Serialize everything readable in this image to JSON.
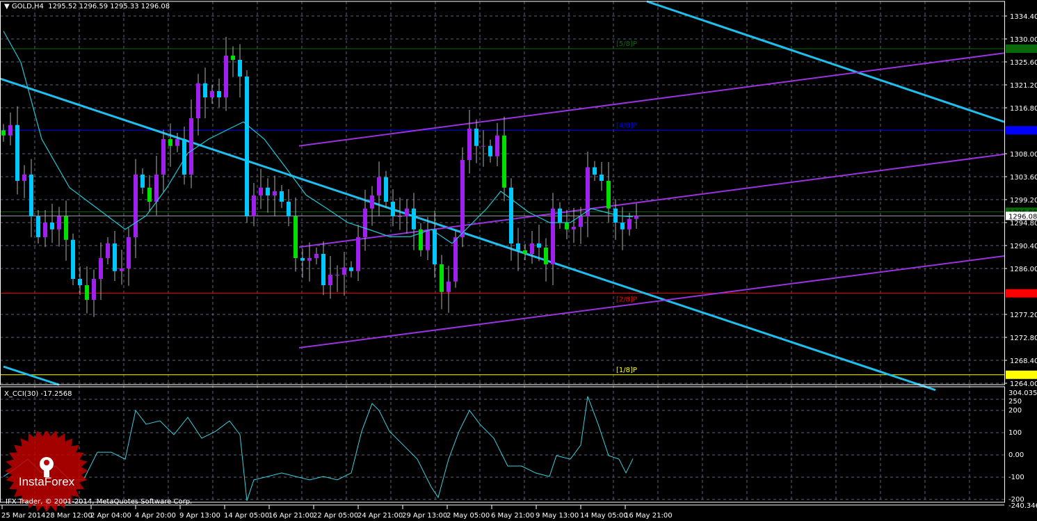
{
  "header": {
    "symbol": "GOLD,H4",
    "ohlc": "1295.52 1296.59 1295.33 1296.08",
    "menu_icon": "triangle-down-icon"
  },
  "indicator_title": "X_CCI(30) -17.2568",
  "copyright": "IFX Trader, © 2001-2014, MetaQuotes Software Corp.",
  "logo": {
    "text": "InstaForex",
    "color": "#c00000"
  },
  "colors": {
    "bull": "#a020f0",
    "bear": "#00c8ff",
    "ma": "#1fc8d8",
    "trend": "#1ec0f0",
    "channel": "#9a32e0",
    "cci": "#39d0e0",
    "grid": "#5a6478"
  },
  "chart_data": [
    {
      "type": "candlestick",
      "symbol": "GOLD",
      "timeframe": "H4",
      "ylim": [
        1264.0,
        1334.4
      ],
      "y_ticks": [
        "1334.40",
        "1330.00",
        "1325.60",
        "1321.20",
        "1316.80",
        "1308.00",
        "1303.60",
        "1299.20",
        "1294.80",
        "1290.40",
        "1286.00",
        "1277.20",
        "1272.80",
        "1268.40",
        "1264.00"
      ],
      "x_ticks": [
        "25 Mar 2014",
        "28 Mar 12:00",
        "2 Apr 04:00",
        "4 Apr 20:00",
        "9 Apr 13:00",
        "14 Apr 05:00",
        "16 Apr 21:00",
        "22 Apr 05:00",
        "24 Apr 21:00",
        "29 Apr 13:00",
        "2 May 05:00",
        "6 May 21:00",
        "9 May 13:00",
        "14 May 05:00",
        "16 May 21:00"
      ],
      "grid": true,
      "closes": [
        1311.5,
        1313.5,
        1302.8,
        1304,
        1296,
        1292,
        1294.8,
        1293.5,
        1296,
        1291.5,
        1284,
        1282.8,
        1280,
        1284,
        1288,
        1290.8,
        1285.5,
        1286,
        1292,
        1304,
        1301.5,
        1298.8,
        1304,
        1310.8,
        1309.5,
        1310.8,
        1304,
        1314.8,
        1321.5,
        1318.8,
        1320,
        1318.8,
        1326.8,
        1326,
        1322.8,
        1296,
        1300,
        1301.5,
        1300,
        1300.8,
        1298.8,
        1296,
        1288,
        1287.5,
        1288,
        1288.8,
        1282.8,
        1284.8,
        1284.8,
        1286.2,
        1285.5,
        1292,
        1297.5,
        1300,
        1303.5,
        1298.8,
        1296,
        1296,
        1297.5,
        1293.5,
        1289.5,
        1293.5,
        1286.8,
        1281.5,
        1283.5,
        1292,
        1306.8,
        1312.8,
        1309.5,
        1309.5,
        1307.5,
        1311.5,
        1301.5,
        1290.8,
        1289.5,
        1288.8,
        1290.8,
        1290,
        1286.8,
        1297.5,
        1294.8,
        1293.5,
        1294,
        1296,
        1305.4,
        1304,
        1302.8,
        1297.5,
        1294.8,
        1293.5,
        1295.5,
        1296.08
      ],
      "moving_average": [
        [
          0,
          1331.5
        ],
        [
          2.5,
          1325.5
        ],
        [
          5.5,
          1310.8
        ],
        [
          9.5,
          1301.5
        ],
        [
          13.5,
          1297.5
        ],
        [
          17.5,
          1293.5
        ],
        [
          20.5,
          1296.1
        ],
        [
          23.5,
          1301.5
        ],
        [
          26.5,
          1308.1
        ],
        [
          29.5,
          1310.8
        ],
        [
          32.5,
          1312.8
        ],
        [
          34.5,
          1314.1
        ],
        [
          37.5,
          1310.8
        ],
        [
          40.5,
          1305.5
        ],
        [
          43.5,
          1300.1
        ],
        [
          46.5,
          1297.5
        ],
        [
          49.5,
          1294.8
        ],
        [
          52.5,
          1293.5
        ],
        [
          55.5,
          1292.1
        ],
        [
          58.5,
          1292.1
        ],
        [
          61.5,
          1293.5
        ],
        [
          64.5,
          1290.8
        ],
        [
          66.5,
          1293.5
        ],
        [
          69.5,
          1297.5
        ],
        [
          71.5,
          1300.8
        ],
        [
          73.5,
          1298.8
        ],
        [
          75.5,
          1296.8
        ],
        [
          78.5,
          1294.8
        ],
        [
          81.5,
          1294.8
        ],
        [
          84.5,
          1297.5
        ],
        [
          86.5,
          1296.8
        ],
        [
          88.5,
          1296.1
        ],
        [
          90.5,
          1295.9
        ]
      ],
      "trend_lines": [
        {
          "from": [
            -0.5,
            1322.4
          ],
          "to": [
            134,
            1262.7
          ],
          "color": "#1ec0f0"
        },
        {
          "from": [
            92.5,
            1337.2
          ],
          "to": [
            143.9,
            1314.1
          ],
          "color": "#1ec0f0"
        },
        {
          "from": [
            0,
            1267.2
          ],
          "to": [
            8,
            1263.7
          ],
          "color": "#1ec0f0"
        },
        {
          "from": [
            42.5,
            1309.5
          ],
          "to": [
            143.9,
            1327.3
          ],
          "color": "#9a32e0"
        },
        {
          "from": [
            42.5,
            1290.1
          ],
          "to": [
            143.9,
            1307.9
          ],
          "color": "#9a32e0"
        },
        {
          "from": [
            42.5,
            1270.8
          ],
          "to": [
            143.9,
            1288.4
          ],
          "color": "#9a32e0"
        }
      ],
      "levels": [
        {
          "price": 1328.13,
          "label": "1328.13",
          "name": "[5/8]P",
          "color": "#0a6a0a",
          "text_color": "#0a6a0a"
        },
        {
          "price": 1312.5,
          "label": "1312.50",
          "name": "[4/8]P",
          "color": "#0000ff",
          "text_color": "#0000ff"
        },
        {
          "price": 1296.88,
          "label": "1296.88",
          "name": "",
          "color": "#0a6a0a",
          "text_color": "#000000"
        },
        {
          "price": 1296.08,
          "label": "1296.08",
          "name": "",
          "color": "#9aa0a8",
          "text_color": "#000000",
          "bg": "#ffffff"
        },
        {
          "price": 1281.25,
          "label": "1281.25",
          "name": "[2/8]P",
          "color": "#ff0000",
          "text_color": "#ff0000"
        },
        {
          "price": 1265.63,
          "label": "1265.63",
          "name": "[1/8]P",
          "color": "#ffff00",
          "text_color": "#ffff00"
        }
      ]
    },
    {
      "type": "line",
      "title": "X_CCI(30) -17.2568",
      "ylim": [
        -240.3463,
        304.0354
      ],
      "y_ticks": [
        "304.0354",
        "250",
        "200",
        "100",
        "0.00",
        "-100",
        "-200",
        "-240.3463"
      ],
      "values": [
        [
          0,
          -97
        ],
        [
          1.5,
          -66
        ],
        [
          3.5,
          -19
        ],
        [
          5.5,
          -81
        ],
        [
          7.5,
          -50
        ],
        [
          9.5,
          -112
        ],
        [
          11.5,
          -112
        ],
        [
          13.5,
          12
        ],
        [
          15.5,
          12
        ],
        [
          17.5,
          -19
        ],
        [
          19,
          200
        ],
        [
          20.5,
          138
        ],
        [
          22.5,
          153
        ],
        [
          24.5,
          91
        ],
        [
          26.5,
          169
        ],
        [
          28.5,
          75
        ],
        [
          30.5,
          106
        ],
        [
          32.5,
          153
        ],
        [
          34,
          91
        ],
        [
          35,
          -206
        ],
        [
          36,
          -112
        ],
        [
          38,
          -97
        ],
        [
          40,
          -81
        ],
        [
          42,
          -97
        ],
        [
          44,
          -112
        ],
        [
          46,
          -97
        ],
        [
          48,
          -112
        ],
        [
          50,
          -81
        ],
        [
          51.5,
          106
        ],
        [
          53,
          231
        ],
        [
          54,
          200
        ],
        [
          55.5,
          106
        ],
        [
          57.5,
          44
        ],
        [
          59.5,
          -19
        ],
        [
          61.5,
          -144
        ],
        [
          62.5,
          -191
        ],
        [
          64,
          -19
        ],
        [
          65.5,
          106
        ],
        [
          67,
          200
        ],
        [
          68.5,
          138
        ],
        [
          70.5,
          75
        ],
        [
          72.5,
          -50
        ],
        [
          74.5,
          -50
        ],
        [
          76.5,
          -81
        ],
        [
          78.5,
          -97
        ],
        [
          79.5,
          -3
        ],
        [
          81.5,
          -19
        ],
        [
          83,
          44
        ],
        [
          84,
          263
        ],
        [
          85.5,
          138
        ],
        [
          87,
          -3
        ],
        [
          88.5,
          -19
        ],
        [
          89.5,
          -81
        ],
        [
          90.5,
          -17
        ]
      ]
    }
  ]
}
